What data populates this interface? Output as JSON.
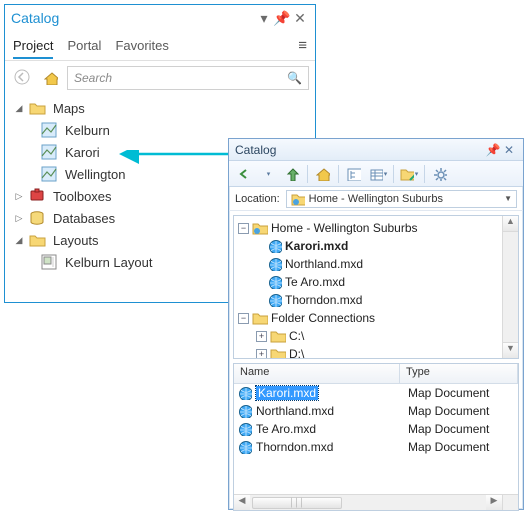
{
  "pro_panel": {
    "title": "Catalog",
    "tabs": [
      "Project",
      "Portal",
      "Favorites"
    ],
    "active_tab": 0,
    "search_placeholder": "Search",
    "tree": {
      "maps": {
        "label": "Maps",
        "items": [
          "Kelburn",
          "Karori",
          "Wellington"
        ]
      },
      "toolboxes": {
        "label": "Toolboxes"
      },
      "databases": {
        "label": "Databases"
      },
      "layouts": {
        "label": "Layouts",
        "items": [
          "Kelburn Layout"
        ]
      }
    }
  },
  "map_panel": {
    "title": "Catalog",
    "location_label": "Location:",
    "location_value": "Home - Wellington Suburbs",
    "tree": {
      "home": {
        "label": "Home - Wellington Suburbs",
        "files": [
          "Karori.mxd",
          "Northland.mxd",
          "Te Aro.mxd",
          "Thorndon.mxd"
        ]
      },
      "folder_connections": {
        "label": "Folder Connections",
        "drives": [
          "C:\\",
          "D:\\"
        ]
      }
    },
    "list": {
      "columns": [
        "Name",
        "Type"
      ],
      "rows": [
        {
          "name": "Karori.mxd",
          "type": "Map Document",
          "selected": true
        },
        {
          "name": "Northland.mxd",
          "type": "Map Document",
          "selected": false
        },
        {
          "name": "Te Aro.mxd",
          "type": "Map Document",
          "selected": false
        },
        {
          "name": "Thorndon.mxd",
          "type": "Map Document",
          "selected": false
        }
      ]
    }
  },
  "colors": {
    "accent": "#1e90d2",
    "arrow": "#00bcd4"
  }
}
